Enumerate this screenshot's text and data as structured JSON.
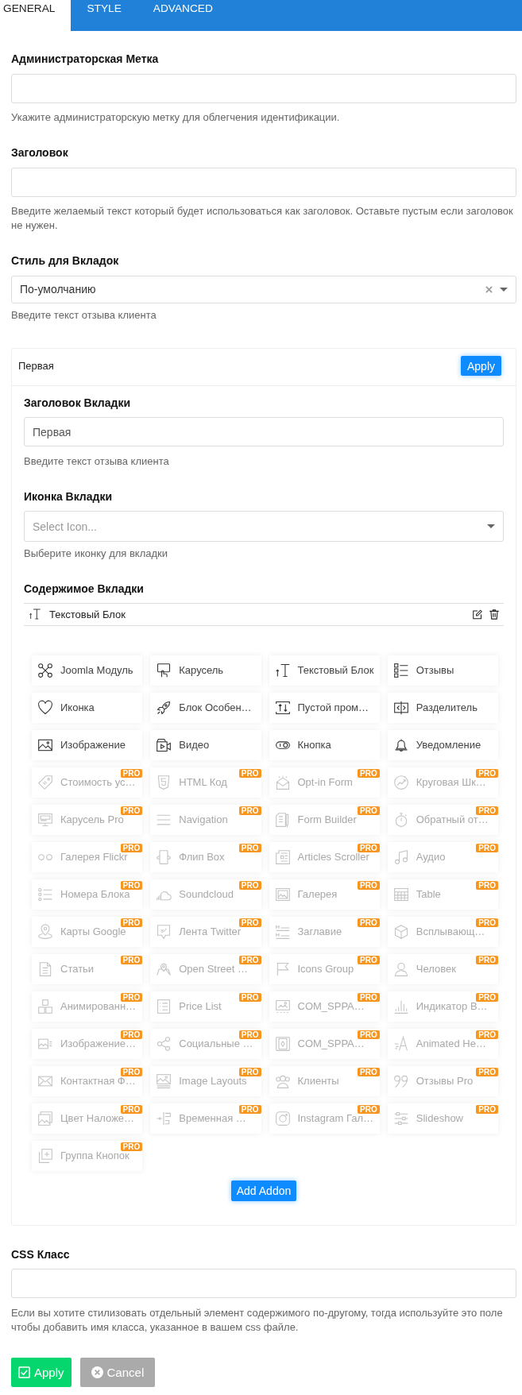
{
  "tabs": [
    {
      "label": "GENERAL",
      "selected": true
    },
    {
      "label": "STYLE",
      "selected": false
    },
    {
      "label": "ADVANCED",
      "selected": false
    }
  ],
  "fields": [
    {
      "kind": "text",
      "label": "Администраторская Метка",
      "help": "Укажите администраторскую метку для облегчения идентификации."
    },
    {
      "kind": "text",
      "label": "Заголовок",
      "help": "Введите желаемый текст который будет использоваться как заголовок. Оставьте пустым если заголовок не нужен."
    },
    {
      "kind": "select",
      "label": "Стиль для Вкладок",
      "value": "По-умолчанию",
      "help": "Введите текст отзыва клиента"
    }
  ],
  "tab_item": {
    "title": "Первая",
    "apply_button": "Apply",
    "fields": [
      {
        "kind": "text",
        "label": "Заголовок Вкладки",
        "value": "Первая",
        "help": "Введите текст отзыва клиента"
      },
      {
        "kind": "select",
        "label": "Иконка Вкладки",
        "placeholder": "Select Icon...",
        "help": "Выберите иконку для вкладки"
      }
    ],
    "content_label": "Содержимое Вкладки",
    "content_items": [
      {
        "label": "Текстовый Блок"
      }
    ],
    "addons": [
      {
        "label": "Joomla Модуль",
        "pro": false
      },
      {
        "label": "Карусель",
        "pro": false
      },
      {
        "label": "Текстовый Блок",
        "pro": false
      },
      {
        "label": "Отзывы",
        "pro": false
      },
      {
        "label": "Иконка",
        "pro": false
      },
      {
        "label": "Блок Особен…",
        "pro": false
      },
      {
        "label": "Пустой пром…",
        "pro": false
      },
      {
        "label": "Разделитель",
        "pro": false
      },
      {
        "label": "Изображение",
        "pro": false
      },
      {
        "label": "Видео",
        "pro": false
      },
      {
        "label": "Кнопка",
        "pro": false
      },
      {
        "label": "Уведомление",
        "pro": false
      },
      {
        "label": "Стоимость ус…",
        "pro": true,
        "badge": "PRO"
      },
      {
        "label": "HTML Код",
        "pro": true,
        "badge": "PRO"
      },
      {
        "label": "Opt-in Form",
        "pro": true,
        "badge": "PRO"
      },
      {
        "label": "Круговая Шк…",
        "pro": true,
        "badge": "PRO"
      },
      {
        "label": "Карусель Pro",
        "pro": true,
        "badge": "PRO"
      },
      {
        "label": "Navigation",
        "pro": true,
        "badge": "PRO"
      },
      {
        "label": "Form Builder",
        "pro": true,
        "badge": "PRO"
      },
      {
        "label": "Обратный от…",
        "pro": true,
        "badge": "PRO"
      },
      {
        "label": "Галерея Flickr",
        "pro": true,
        "badge": "PRO"
      },
      {
        "label": "Флип Box",
        "pro": true,
        "badge": "PRO"
      },
      {
        "label": "Articles Scroller",
        "pro": true,
        "badge": "PRO"
      },
      {
        "label": "Аудио",
        "pro": true,
        "badge": "PRO"
      },
      {
        "label": "Номера Блока",
        "pro": true,
        "badge": "PRO"
      },
      {
        "label": "Soundcloud",
        "pro": true,
        "badge": "PRO"
      },
      {
        "label": "Галерея",
        "pro": true,
        "badge": "PRO"
      },
      {
        "label": "Table",
        "pro": true,
        "badge": "PRO"
      },
      {
        "label": "Карты Google",
        "pro": true,
        "badge": "PRO"
      },
      {
        "label": "Лента Twitter",
        "pro": true,
        "badge": "PRO"
      },
      {
        "label": "Заглавие",
        "pro": true,
        "badge": "PRO"
      },
      {
        "label": "Всплывающ…",
        "pro": true,
        "badge": "PRO"
      },
      {
        "label": "Статьи",
        "pro": true,
        "badge": "PRO"
      },
      {
        "label": "Open Street …",
        "pro": true,
        "badge": "PRO"
      },
      {
        "label": "Icons Group",
        "pro": true,
        "badge": "PRO"
      },
      {
        "label": "Человек",
        "pro": true,
        "badge": "PRO"
      },
      {
        "label": "Анимированн…",
        "pro": true,
        "badge": "PRO"
      },
      {
        "label": "Price List",
        "pro": true,
        "badge": "PRO"
      },
      {
        "label": "COM_SPPA…",
        "pro": true,
        "badge": "PRO"
      },
      {
        "label": "Индикатор В…",
        "pro": true,
        "badge": "PRO"
      },
      {
        "label": "Изображение…",
        "pro": true,
        "badge": "PRO"
      },
      {
        "label": "Социальные …",
        "pro": true,
        "badge": "PRO"
      },
      {
        "label": "COM_SPPA…",
        "pro": true,
        "badge": "PRO"
      },
      {
        "label": "Animated He…",
        "pro": true,
        "badge": "PRO"
      },
      {
        "label": "Контактная Ф…",
        "pro": true,
        "badge": "PRO"
      },
      {
        "label": "Image Layouts",
        "pro": true,
        "badge": "PRO"
      },
      {
        "label": "Клиенты",
        "pro": true,
        "badge": "PRO"
      },
      {
        "label": "Отзывы Pro",
        "pro": true,
        "badge": "PRO"
      },
      {
        "label": "Цвет Наложе…",
        "pro": true,
        "badge": "PRO"
      },
      {
        "label": "Временная …",
        "pro": true,
        "badge": "PRO"
      },
      {
        "label": "Instagram Гал…",
        "pro": true,
        "badge": "PRO"
      },
      {
        "label": "Slideshow",
        "pro": true,
        "badge": "PRO"
      },
      {
        "label": "Группа Кнопок",
        "pro": true,
        "badge": "PRO"
      }
    ],
    "add_button": "Add Addon"
  },
  "css_field": {
    "kind": "text",
    "label": "CSS Класс",
    "help": "Если вы хотите стилизовать отдельный элемент содержимого по-другому, тогда используйте это поле чтобы добавить имя класса, указанное в вашем css файле."
  },
  "buttons": [
    {
      "kind": "apply",
      "label": "Apply"
    },
    {
      "kind": "cancel",
      "label": "Cancel"
    }
  ]
}
